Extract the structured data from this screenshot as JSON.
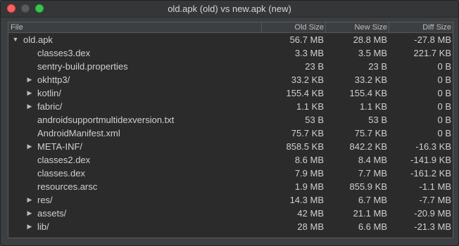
{
  "window": {
    "title": "old.apk (old) vs new.apk (new)"
  },
  "columns": {
    "file": "File",
    "old": "Old Size",
    "new": "New Size",
    "diff": "Diff Size"
  },
  "rows": [
    {
      "name": "old.apk",
      "old": "56.7 MB",
      "new": "28.8 MB",
      "diff": "-27.8 MB",
      "level": 0,
      "expander": "expanded"
    },
    {
      "name": "classes3.dex",
      "old": "3.3 MB",
      "new": "3.5 MB",
      "diff": "221.7 KB",
      "level": 1,
      "expander": "none"
    },
    {
      "name": "sentry-build.properties",
      "old": "23 B",
      "new": "23 B",
      "diff": "0 B",
      "level": 1,
      "expander": "none"
    },
    {
      "name": "okhttp3/",
      "old": "33.2 KB",
      "new": "33.2 KB",
      "diff": "0 B",
      "level": 1,
      "expander": "collapsed"
    },
    {
      "name": "kotlin/",
      "old": "155.4 KB",
      "new": "155.4 KB",
      "diff": "0 B",
      "level": 1,
      "expander": "collapsed"
    },
    {
      "name": "fabric/",
      "old": "1.1 KB",
      "new": "1.1 KB",
      "diff": "0 B",
      "level": 1,
      "expander": "collapsed"
    },
    {
      "name": "androidsupportmultidexversion.txt",
      "old": "53 B",
      "new": "53 B",
      "diff": "0 B",
      "level": 1,
      "expander": "none"
    },
    {
      "name": "AndroidManifest.xml",
      "old": "75.7 KB",
      "new": "75.7 KB",
      "diff": "0 B",
      "level": 1,
      "expander": "none"
    },
    {
      "name": "META-INF/",
      "old": "858.5 KB",
      "new": "842.2 KB",
      "diff": "-16.3 KB",
      "level": 1,
      "expander": "collapsed"
    },
    {
      "name": "classes2.dex",
      "old": "8.6 MB",
      "new": "8.4 MB",
      "diff": "-141.9 KB",
      "level": 1,
      "expander": "none"
    },
    {
      "name": "classes.dex",
      "old": "7.9 MB",
      "new": "7.7 MB",
      "diff": "-161.2 KB",
      "level": 1,
      "expander": "none"
    },
    {
      "name": "resources.arsc",
      "old": "1.9 MB",
      "new": "855.9 KB",
      "diff": "-1.1 MB",
      "level": 1,
      "expander": "none"
    },
    {
      "name": "res/",
      "old": "14.3 MB",
      "new": "6.7 MB",
      "diff": "-7.7 MB",
      "level": 1,
      "expander": "collapsed"
    },
    {
      "name": "assets/",
      "old": "42 MB",
      "new": "21.1 MB",
      "diff": "-20.9 MB",
      "level": 1,
      "expander": "collapsed"
    },
    {
      "name": "lib/",
      "old": "28 MB",
      "new": "6.6 MB",
      "diff": "-21.3 MB",
      "level": 1,
      "expander": "collapsed"
    }
  ]
}
